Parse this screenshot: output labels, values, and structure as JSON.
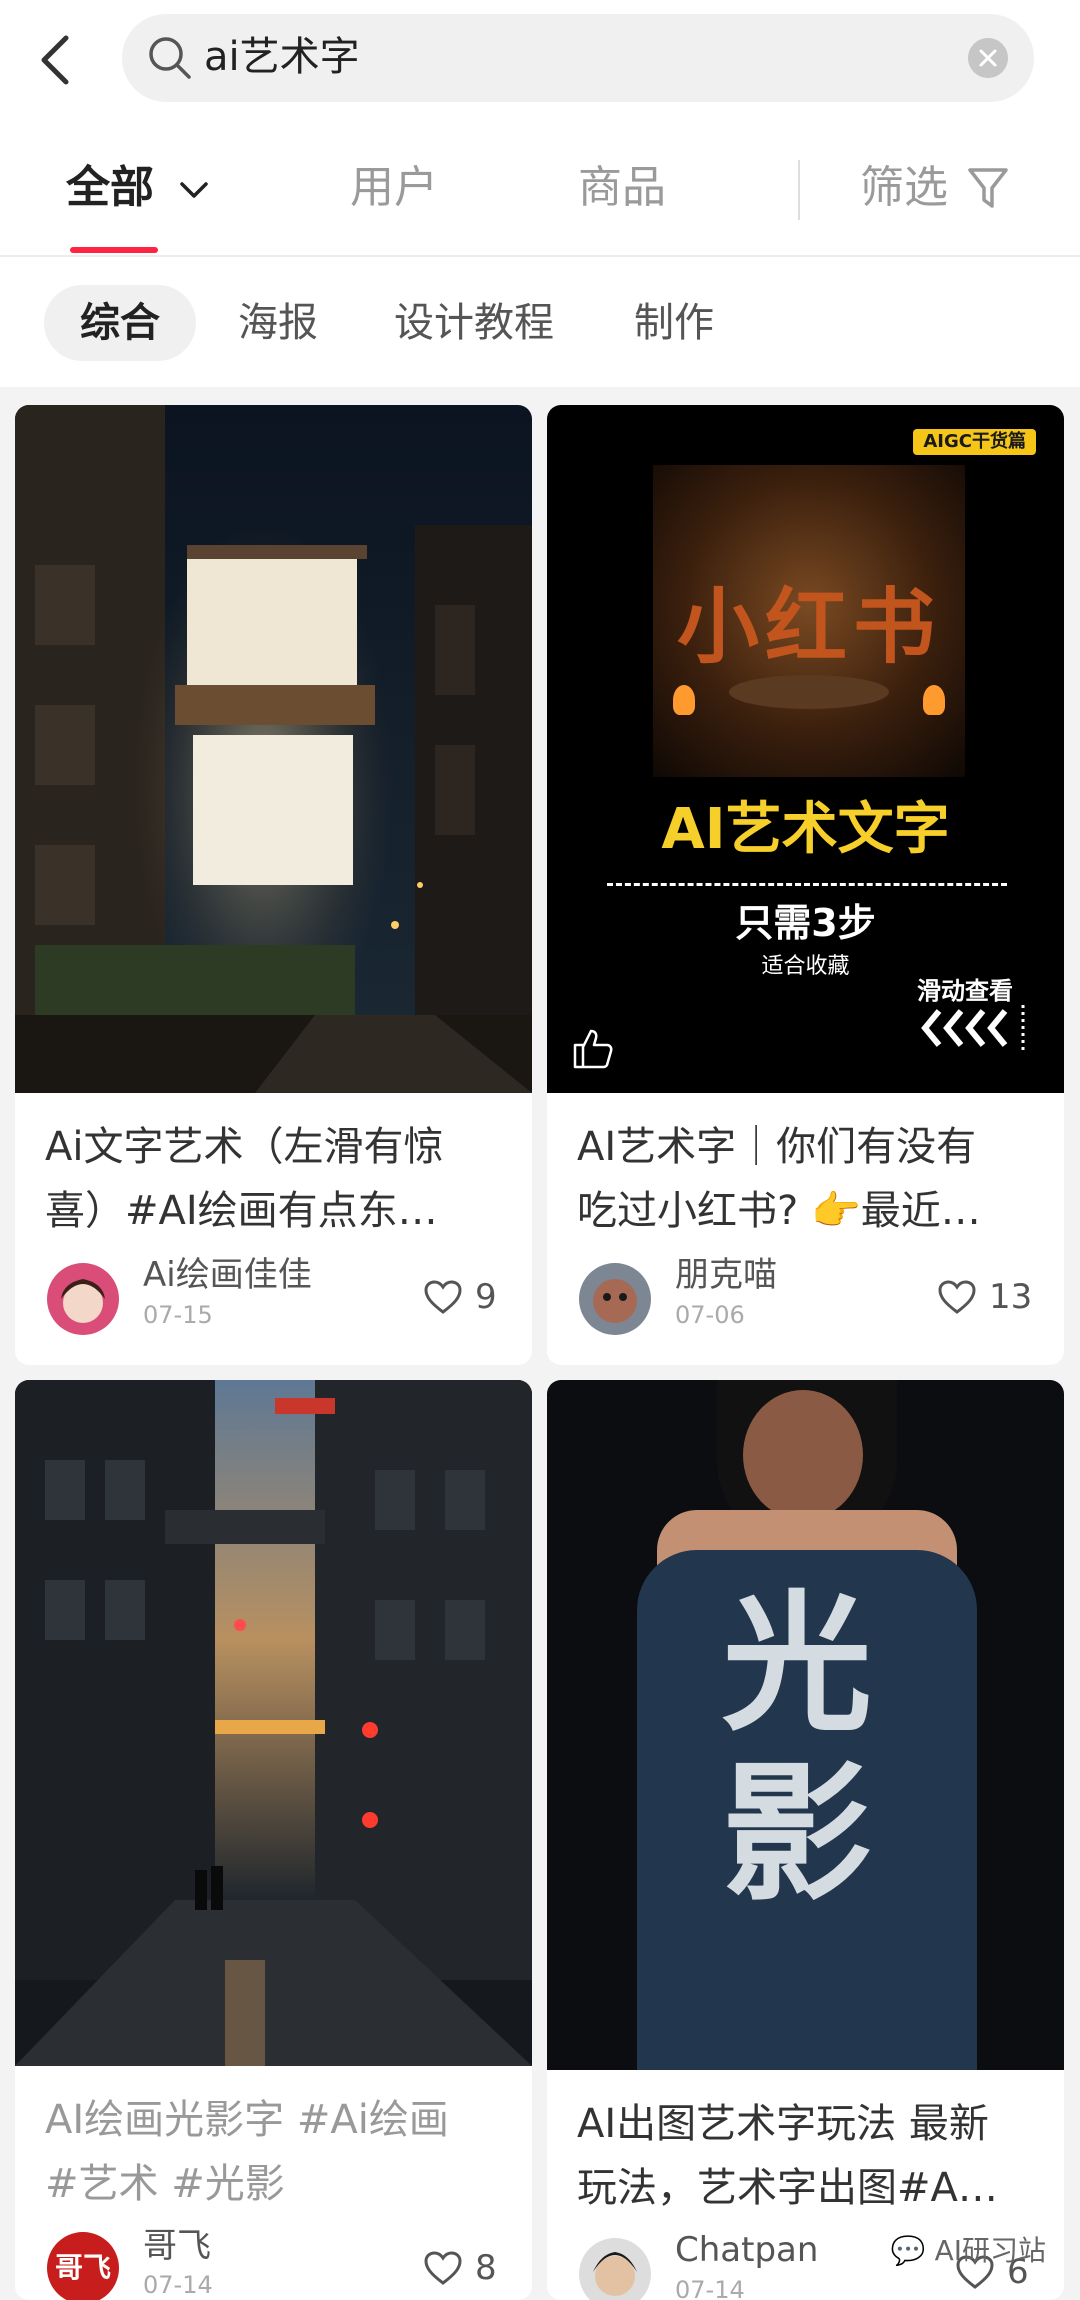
{
  "search": {
    "query": "ai艺术字"
  },
  "tabs": [
    {
      "label": "全部"
    },
    {
      "label": "用户"
    },
    {
      "label": "商品"
    },
    {
      "label": "筛选"
    }
  ],
  "chips": [
    {
      "label": "综合"
    },
    {
      "label": "海报"
    },
    {
      "label": "设计教程"
    },
    {
      "label": "制作"
    }
  ],
  "posts": [
    {
      "title_line1": "Ai文字艺术（左滑有惊",
      "title_line2": "喜）#AI绘画有点东…",
      "author": "Ai绘画佳佳",
      "date": "07-15",
      "likes": "9"
    },
    {
      "title_line1": "AI艺术字｜你们有没有",
      "title_line2": "吃过小红书? 👉最近…",
      "author": "朋克喵",
      "date": "07-06",
      "likes": "13",
      "poster": {
        "badge": "AIGC干货篇",
        "headline": "AI艺术文字",
        "steps": "只需3步",
        "sub": "适合收藏",
        "swipe": "滑动查看",
        "art": "小红书"
      }
    },
    {
      "title_line1": "AI绘画光影字 #Ai绘画",
      "title_line2": "#艺术 #光影",
      "author": "哥飞",
      "date": "07-14",
      "likes": "8",
      "avatar_text": "哥飞"
    },
    {
      "title_line1": "AI出图艺术字玩法 最新",
      "title_line2": "玩法，艺术字出图#A…",
      "author": "Chatpan",
      "date": "07-14",
      "likes": "6",
      "art": "光 影"
    }
  ],
  "watermark": "AI研习站"
}
